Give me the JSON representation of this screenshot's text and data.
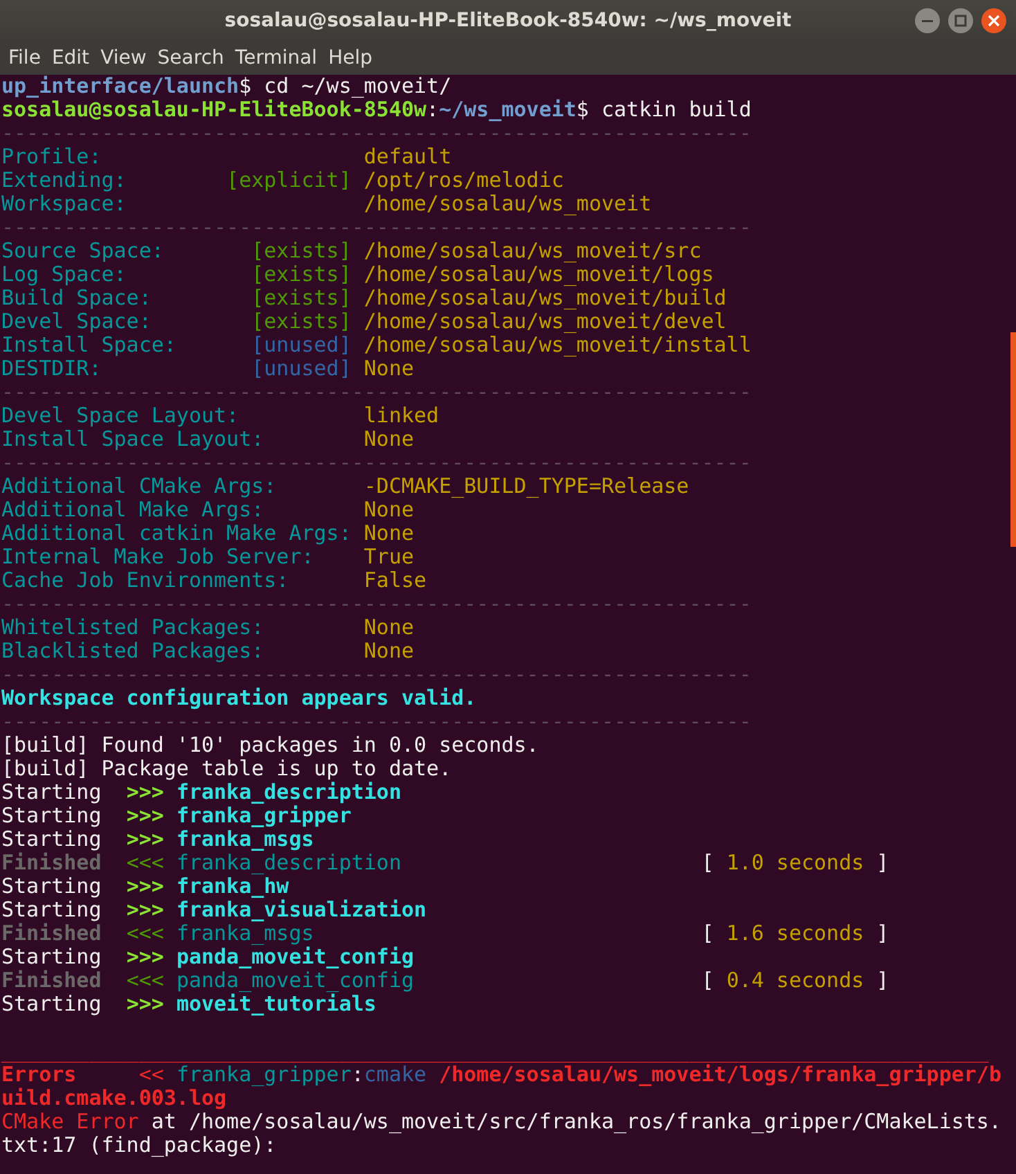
{
  "window": {
    "title": "sosalau@sosalau-HP-EliteBook-8540w: ~/ws_moveit"
  },
  "menu": [
    "File",
    "Edit",
    "View",
    "Search",
    "Terminal",
    "Help"
  ],
  "terminal": {
    "lines": [
      {
        "kind": "text",
        "segments": [
          {
            "text": "up_interface/launch",
            "kind": "prompt_path"
          },
          {
            "text": "$ cd ~/ws_moveit/",
            "kind": "plain"
          }
        ]
      },
      {
        "kind": "text",
        "segments": [
          {
            "text": "sosalau@sosalau-HP-EliteBook-8540w",
            "kind": "prompt_user"
          },
          {
            "text": ":",
            "kind": "plain"
          },
          {
            "text": "~/ws_moveit",
            "kind": "prompt_path"
          },
          {
            "text": "$ catkin build",
            "kind": "plain"
          }
        ]
      },
      {
        "kind": "text",
        "segments": [
          {
            "text": "------------------------------------------------------------",
            "kind": "dash"
          }
        ]
      },
      {
        "kind": "text",
        "segments": [
          {
            "text": "Profile:                     ",
            "kind": "label"
          },
          {
            "text": "default",
            "kind": "value"
          }
        ]
      },
      {
        "kind": "text",
        "segments": [
          {
            "text": "Extending:        ",
            "kind": "label"
          },
          {
            "text": "[explicit]",
            "kind": "tag_green"
          },
          {
            "text": " /opt/ros/melodic",
            "kind": "value"
          }
        ]
      },
      {
        "kind": "text",
        "segments": [
          {
            "text": "Workspace:                   ",
            "kind": "label"
          },
          {
            "text": "/home/sosalau/ws_moveit",
            "kind": "value"
          }
        ]
      },
      {
        "kind": "text",
        "segments": [
          {
            "text": "------------------------------------------------------------",
            "kind": "dash"
          }
        ]
      },
      {
        "kind": "text",
        "segments": [
          {
            "text": "Source Space:       ",
            "kind": "label"
          },
          {
            "text": "[exists]",
            "kind": "tag_green"
          },
          {
            "text": " /home/sosalau/ws_moveit/src",
            "kind": "value"
          }
        ]
      },
      {
        "kind": "text",
        "segments": [
          {
            "text": "Log Space:          ",
            "kind": "label"
          },
          {
            "text": "[exists]",
            "kind": "tag_green"
          },
          {
            "text": " /home/sosalau/ws_moveit/logs",
            "kind": "value"
          }
        ]
      },
      {
        "kind": "text",
        "segments": [
          {
            "text": "Build Space:        ",
            "kind": "label"
          },
          {
            "text": "[exists]",
            "kind": "tag_green"
          },
          {
            "text": " /home/sosalau/ws_moveit/build",
            "kind": "value"
          }
        ]
      },
      {
        "kind": "text",
        "segments": [
          {
            "text": "Devel Space:        ",
            "kind": "label"
          },
          {
            "text": "[exists]",
            "kind": "tag_green"
          },
          {
            "text": " /home/sosalau/ws_moveit/devel",
            "kind": "value"
          }
        ]
      },
      {
        "kind": "text",
        "segments": [
          {
            "text": "Install Space:      ",
            "kind": "label"
          },
          {
            "text": "[unused]",
            "kind": "tag_blue"
          },
          {
            "text": " /home/sosalau/ws_moveit/install",
            "kind": "value"
          }
        ]
      },
      {
        "kind": "text",
        "segments": [
          {
            "text": "DESTDIR:            ",
            "kind": "label"
          },
          {
            "text": "[unused]",
            "kind": "tag_blue"
          },
          {
            "text": " None",
            "kind": "value"
          }
        ]
      },
      {
        "kind": "text",
        "segments": [
          {
            "text": "------------------------------------------------------------",
            "kind": "dash"
          }
        ]
      },
      {
        "kind": "text",
        "segments": [
          {
            "text": "Devel Space Layout:          ",
            "kind": "label"
          },
          {
            "text": "linked",
            "kind": "value"
          }
        ]
      },
      {
        "kind": "text",
        "segments": [
          {
            "text": "Install Space Layout:        ",
            "kind": "label"
          },
          {
            "text": "None",
            "kind": "value"
          }
        ]
      },
      {
        "kind": "text",
        "segments": [
          {
            "text": "------------------------------------------------------------",
            "kind": "dash"
          }
        ]
      },
      {
        "kind": "text",
        "segments": [
          {
            "text": "Additional CMake Args:       ",
            "kind": "label"
          },
          {
            "text": "-DCMAKE_BUILD_TYPE=Release",
            "kind": "value"
          }
        ]
      },
      {
        "kind": "text",
        "segments": [
          {
            "text": "Additional Make Args:        ",
            "kind": "label"
          },
          {
            "text": "None",
            "kind": "value"
          }
        ]
      },
      {
        "kind": "text",
        "segments": [
          {
            "text": "Additional catkin Make Args: ",
            "kind": "label"
          },
          {
            "text": "None",
            "kind": "value"
          }
        ]
      },
      {
        "kind": "text",
        "segments": [
          {
            "text": "Internal Make Job Server:    ",
            "kind": "label"
          },
          {
            "text": "True",
            "kind": "value"
          }
        ]
      },
      {
        "kind": "text",
        "segments": [
          {
            "text": "Cache Job Environments:      ",
            "kind": "label"
          },
          {
            "text": "False",
            "kind": "value"
          }
        ]
      },
      {
        "kind": "text",
        "segments": [
          {
            "text": "------------------------------------------------------------",
            "kind": "dash"
          }
        ]
      },
      {
        "kind": "text",
        "segments": [
          {
            "text": "Whitelisted Packages:        ",
            "kind": "label"
          },
          {
            "text": "None",
            "kind": "value"
          }
        ]
      },
      {
        "kind": "text",
        "segments": [
          {
            "text": "Blacklisted Packages:        ",
            "kind": "label"
          },
          {
            "text": "None",
            "kind": "value"
          }
        ]
      },
      {
        "kind": "text",
        "segments": [
          {
            "text": "------------------------------------------------------------",
            "kind": "dash"
          }
        ]
      },
      {
        "kind": "text",
        "segments": [
          {
            "text": "Workspace configuration appears valid.",
            "kind": "ok"
          }
        ]
      },
      {
        "kind": "text",
        "segments": [
          {
            "text": "------------------------------------------------------------",
            "kind": "dash"
          }
        ]
      },
      {
        "kind": "text",
        "segments": [
          {
            "text": "[build] Found '10' packages in 0.0 seconds.",
            "kind": "plain"
          }
        ]
      },
      {
        "kind": "text",
        "segments": [
          {
            "text": "[build] Package table is up to date.",
            "kind": "plain"
          }
        ]
      },
      {
        "kind": "text",
        "segments": [
          {
            "text": "Starting  ",
            "kind": "plain"
          },
          {
            "text": ">>> ",
            "kind": "arrow_start"
          },
          {
            "text": "franka_description",
            "kind": "pkg_start"
          }
        ]
      },
      {
        "kind": "text",
        "segments": [
          {
            "text": "Starting  ",
            "kind": "plain"
          },
          {
            "text": ">>> ",
            "kind": "arrow_start"
          },
          {
            "text": "franka_gripper",
            "kind": "pkg_start"
          }
        ]
      },
      {
        "kind": "text",
        "segments": [
          {
            "text": "Starting  ",
            "kind": "plain"
          },
          {
            "text": ">>> ",
            "kind": "arrow_start"
          },
          {
            "text": "franka_msgs",
            "kind": "pkg_start"
          }
        ]
      },
      {
        "kind": "text",
        "segments": [
          {
            "text": "Finished  ",
            "kind": "finished"
          },
          {
            "text": "<<< ",
            "kind": "arrow_done"
          },
          {
            "text": "franka_description",
            "kind": "pkg_done"
          },
          {
            "text": "                        [ ",
            "kind": "plain"
          },
          {
            "text": "1.0 seconds",
            "kind": "value"
          },
          {
            "text": " ]",
            "kind": "plain"
          }
        ]
      },
      {
        "kind": "text",
        "segments": [
          {
            "text": "Starting  ",
            "kind": "plain"
          },
          {
            "text": ">>> ",
            "kind": "arrow_start"
          },
          {
            "text": "franka_hw",
            "kind": "pkg_start"
          }
        ]
      },
      {
        "kind": "text",
        "segments": [
          {
            "text": "Starting  ",
            "kind": "plain"
          },
          {
            "text": ">>> ",
            "kind": "arrow_start"
          },
          {
            "text": "franka_visualization",
            "kind": "pkg_start"
          }
        ]
      },
      {
        "kind": "text",
        "segments": [
          {
            "text": "Finished  ",
            "kind": "finished"
          },
          {
            "text": "<<< ",
            "kind": "arrow_done"
          },
          {
            "text": "franka_msgs",
            "kind": "pkg_done"
          },
          {
            "text": "                               [ ",
            "kind": "plain"
          },
          {
            "text": "1.6 seconds",
            "kind": "value"
          },
          {
            "text": " ]",
            "kind": "plain"
          }
        ]
      },
      {
        "kind": "text",
        "segments": [
          {
            "text": "Starting  ",
            "kind": "plain"
          },
          {
            "text": ">>> ",
            "kind": "arrow_start"
          },
          {
            "text": "panda_moveit_config",
            "kind": "pkg_start"
          }
        ]
      },
      {
        "kind": "text",
        "segments": [
          {
            "text": "Finished  ",
            "kind": "finished"
          },
          {
            "text": "<<< ",
            "kind": "arrow_done"
          },
          {
            "text": "panda_moveit_config",
            "kind": "pkg_done"
          },
          {
            "text": "                       [ ",
            "kind": "plain"
          },
          {
            "text": "0.4 seconds",
            "kind": "value"
          },
          {
            "text": " ]",
            "kind": "plain"
          }
        ]
      },
      {
        "kind": "text",
        "segments": [
          {
            "text": "Starting  ",
            "kind": "plain"
          },
          {
            "text": ">>> ",
            "kind": "arrow_start"
          },
          {
            "text": "moveit_tutorials",
            "kind": "pkg_start"
          }
        ]
      },
      {
        "kind": "blank"
      },
      {
        "kind": "text",
        "segments": [
          {
            "text": "_______________________________________________________________________________",
            "kind": "error_plain"
          }
        ]
      },
      {
        "kind": "text",
        "segments": [
          {
            "text": "Errors     ",
            "kind": "error"
          },
          {
            "text": "<< ",
            "kind": "error_plain"
          },
          {
            "text": "franka_gripper",
            "kind": "pkg_done"
          },
          {
            "text": ":",
            "kind": "plain"
          },
          {
            "text": "cmake ",
            "kind": "stage"
          },
          {
            "text": "/home/sosalau/ws_moveit/logs/franka_gripper/b",
            "kind": "error"
          }
        ]
      },
      {
        "kind": "text",
        "segments": [
          {
            "text": "uild.cmake.003.log",
            "kind": "error"
          }
        ]
      },
      {
        "kind": "text",
        "segments": [
          {
            "text": "CMake Error",
            "kind": "error_plain"
          },
          {
            "text": " at /home/sosalau/ws_moveit/src/franka_ros/franka_gripper/CMakeLists.",
            "kind": "plain"
          }
        ]
      },
      {
        "kind": "text",
        "segments": [
          {
            "text": "txt:17 (find_package):",
            "kind": "plain"
          }
        ]
      }
    ]
  }
}
